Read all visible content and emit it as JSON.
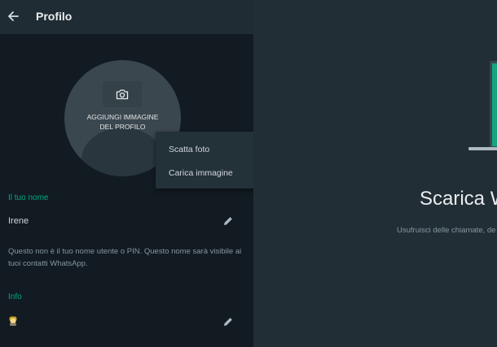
{
  "header": {
    "title": "Profilo",
    "back_icon": "arrow-left-icon"
  },
  "avatar": {
    "label": "AGGIUNGI IMMAGINE DEL PROFILO",
    "icon": "camera-icon"
  },
  "photo_menu": {
    "items": [
      {
        "label": "Scatta foto"
      },
      {
        "label": "Carica immagine"
      }
    ]
  },
  "name_section": {
    "label": "Il tuo nome",
    "value": "Irene",
    "edit_icon": "pencil-icon",
    "description": "Questo non è il tuo nome utente o PIN. Questo nome sarà visibile ai tuoi contatti WhatsApp."
  },
  "info_section": {
    "label": "Info",
    "value_icon": "emoji-icon",
    "edit_icon": "pencil-icon"
  },
  "intro": {
    "title": "Scarica W",
    "subtitle": "Usufruisci delle chiamate, de"
  },
  "colors": {
    "accent": "#00a884",
    "panel_bg": "#111b21",
    "header_bg": "#202c33",
    "right_bg": "#222e35",
    "menu_bg": "#233138"
  }
}
